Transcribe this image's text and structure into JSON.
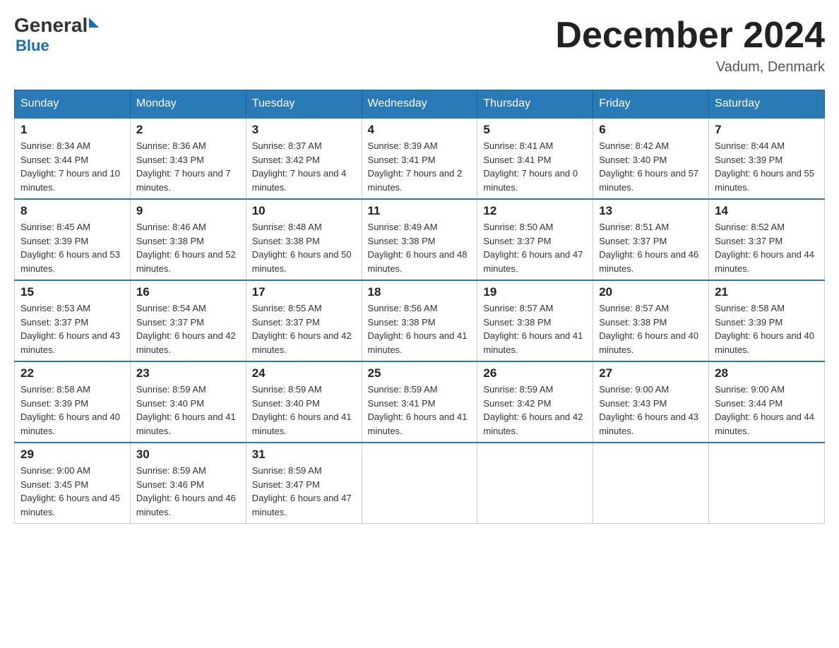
{
  "logo": {
    "general": "General",
    "blue": "Blue"
  },
  "title": "December 2024",
  "location": "Vadum, Denmark",
  "days_of_week": [
    "Sunday",
    "Monday",
    "Tuesday",
    "Wednesday",
    "Thursday",
    "Friday",
    "Saturday"
  ],
  "weeks": [
    [
      {
        "day": "1",
        "sunrise": "8:34 AM",
        "sunset": "3:44 PM",
        "daylight": "7 hours and 10 minutes."
      },
      {
        "day": "2",
        "sunrise": "8:36 AM",
        "sunset": "3:43 PM",
        "daylight": "7 hours and 7 minutes."
      },
      {
        "day": "3",
        "sunrise": "8:37 AM",
        "sunset": "3:42 PM",
        "daylight": "7 hours and 4 minutes."
      },
      {
        "day": "4",
        "sunrise": "8:39 AM",
        "sunset": "3:41 PM",
        "daylight": "7 hours and 2 minutes."
      },
      {
        "day": "5",
        "sunrise": "8:41 AM",
        "sunset": "3:41 PM",
        "daylight": "7 hours and 0 minutes."
      },
      {
        "day": "6",
        "sunrise": "8:42 AM",
        "sunset": "3:40 PM",
        "daylight": "6 hours and 57 minutes."
      },
      {
        "day": "7",
        "sunrise": "8:44 AM",
        "sunset": "3:39 PM",
        "daylight": "6 hours and 55 minutes."
      }
    ],
    [
      {
        "day": "8",
        "sunrise": "8:45 AM",
        "sunset": "3:39 PM",
        "daylight": "6 hours and 53 minutes."
      },
      {
        "day": "9",
        "sunrise": "8:46 AM",
        "sunset": "3:38 PM",
        "daylight": "6 hours and 52 minutes."
      },
      {
        "day": "10",
        "sunrise": "8:48 AM",
        "sunset": "3:38 PM",
        "daylight": "6 hours and 50 minutes."
      },
      {
        "day": "11",
        "sunrise": "8:49 AM",
        "sunset": "3:38 PM",
        "daylight": "6 hours and 48 minutes."
      },
      {
        "day": "12",
        "sunrise": "8:50 AM",
        "sunset": "3:37 PM",
        "daylight": "6 hours and 47 minutes."
      },
      {
        "day": "13",
        "sunrise": "8:51 AM",
        "sunset": "3:37 PM",
        "daylight": "6 hours and 46 minutes."
      },
      {
        "day": "14",
        "sunrise": "8:52 AM",
        "sunset": "3:37 PM",
        "daylight": "6 hours and 44 minutes."
      }
    ],
    [
      {
        "day": "15",
        "sunrise": "8:53 AM",
        "sunset": "3:37 PM",
        "daylight": "6 hours and 43 minutes."
      },
      {
        "day": "16",
        "sunrise": "8:54 AM",
        "sunset": "3:37 PM",
        "daylight": "6 hours and 42 minutes."
      },
      {
        "day": "17",
        "sunrise": "8:55 AM",
        "sunset": "3:37 PM",
        "daylight": "6 hours and 42 minutes."
      },
      {
        "day": "18",
        "sunrise": "8:56 AM",
        "sunset": "3:38 PM",
        "daylight": "6 hours and 41 minutes."
      },
      {
        "day": "19",
        "sunrise": "8:57 AM",
        "sunset": "3:38 PM",
        "daylight": "6 hours and 41 minutes."
      },
      {
        "day": "20",
        "sunrise": "8:57 AM",
        "sunset": "3:38 PM",
        "daylight": "6 hours and 40 minutes."
      },
      {
        "day": "21",
        "sunrise": "8:58 AM",
        "sunset": "3:39 PM",
        "daylight": "6 hours and 40 minutes."
      }
    ],
    [
      {
        "day": "22",
        "sunrise": "8:58 AM",
        "sunset": "3:39 PM",
        "daylight": "6 hours and 40 minutes."
      },
      {
        "day": "23",
        "sunrise": "8:59 AM",
        "sunset": "3:40 PM",
        "daylight": "6 hours and 41 minutes."
      },
      {
        "day": "24",
        "sunrise": "8:59 AM",
        "sunset": "3:40 PM",
        "daylight": "6 hours and 41 minutes."
      },
      {
        "day": "25",
        "sunrise": "8:59 AM",
        "sunset": "3:41 PM",
        "daylight": "6 hours and 41 minutes."
      },
      {
        "day": "26",
        "sunrise": "8:59 AM",
        "sunset": "3:42 PM",
        "daylight": "6 hours and 42 minutes."
      },
      {
        "day": "27",
        "sunrise": "9:00 AM",
        "sunset": "3:43 PM",
        "daylight": "6 hours and 43 minutes."
      },
      {
        "day": "28",
        "sunrise": "9:00 AM",
        "sunset": "3:44 PM",
        "daylight": "6 hours and 44 minutes."
      }
    ],
    [
      {
        "day": "29",
        "sunrise": "9:00 AM",
        "sunset": "3:45 PM",
        "daylight": "6 hours and 45 minutes."
      },
      {
        "day": "30",
        "sunrise": "8:59 AM",
        "sunset": "3:46 PM",
        "daylight": "6 hours and 46 minutes."
      },
      {
        "day": "31",
        "sunrise": "8:59 AM",
        "sunset": "3:47 PM",
        "daylight": "6 hours and 47 minutes."
      },
      null,
      null,
      null,
      null
    ]
  ]
}
